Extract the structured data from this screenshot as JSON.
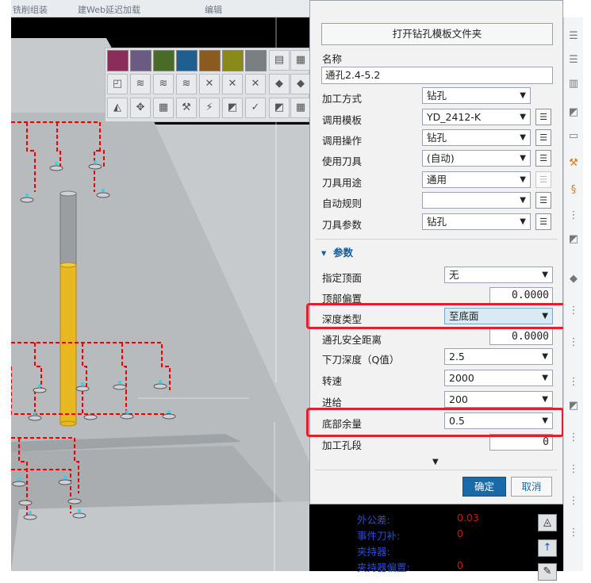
{
  "topbar": {
    "text_left": "铣削组装",
    "text_mid": "建Web延迟加载",
    "text_right": "编辑"
  },
  "palette_colors": [
    "#8b2d5a",
    "#6b5a84",
    "#4a6a2a",
    "#1f5f8f",
    "#8a5a20",
    "#8a8a1a",
    "#7a7f84"
  ],
  "dialog": {
    "open_template_folder": "打开钻孔模板文件夹",
    "name_label": "名称",
    "name_value": "通孔2.4-5.2",
    "fields": [
      {
        "label": "加工方式",
        "value": "钻孔"
      },
      {
        "label": "调用模板",
        "value": "YD_2412-K"
      },
      {
        "label": "调用操作",
        "value": "钻孔"
      },
      {
        "label": "使用刀具",
        "value": "(自动)"
      },
      {
        "label": "刀具用途",
        "value": "通用"
      },
      {
        "label": "自动规则",
        "value": ""
      },
      {
        "label": "刀具参数",
        "value": "钻孔"
      }
    ],
    "params_title": "参数",
    "params": {
      "top_face_label": "指定顶面",
      "top_face_value": "无",
      "top_offset_label": "顶部偏置",
      "top_offset_value": "0.0000",
      "depth_type_label": "深度类型",
      "depth_type_value": "至底面",
      "safe_dist_label": "通孔安全距离",
      "safe_dist_value": "0.0000",
      "step_depth_label": "下刀深度（Q值）",
      "step_depth_value": "2.5",
      "speed_label": "转速",
      "speed_value": "2000",
      "feed_label": "进给",
      "feed_value": "200",
      "bottom_stock_label": "底部余量",
      "bottom_stock_value": "0.5",
      "segment_label": "加工孔段",
      "segment_value": "0"
    },
    "ok": "确定",
    "cancel": "取消"
  },
  "info": [
    {
      "k": "外公差:",
      "v": "0.03"
    },
    {
      "k": "事件刀补:",
      "v": "0"
    },
    {
      "k": "夹持器:",
      "v": ""
    },
    {
      "k": "夹持器偏置:",
      "v": "0"
    }
  ],
  "colors": {
    "accent": "#135c9c",
    "highlight": "#e0202f",
    "ok_bg": "#1a6aa8",
    "info_key": "#2b4bd8",
    "info_val": "#c41a1a"
  }
}
